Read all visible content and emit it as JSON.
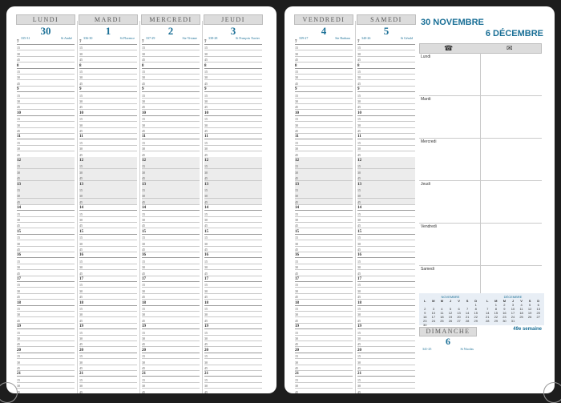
{
  "left_days": [
    {
      "name": "LUNDI",
      "num": "30",
      "code": "335-31",
      "saint": "St André"
    },
    {
      "name": "MARDI",
      "num": "1",
      "code": "336-30",
      "saint": "St Florence"
    },
    {
      "name": "MERCREDI",
      "num": "2",
      "code": "337-29",
      "saint": "Ste Viviane"
    },
    {
      "name": "JEUDI",
      "num": "3",
      "code": "338-28",
      "saint": "St François Xavier"
    }
  ],
  "right_days": [
    {
      "name": "VENDREDI",
      "num": "4",
      "code": "339-27",
      "saint": "Ste Barbara"
    },
    {
      "name": "SAMEDI",
      "num": "5",
      "code": "340-26",
      "saint": "St Gérald"
    }
  ],
  "hours": [
    "7",
    "8",
    "9",
    "10",
    "11",
    "12",
    "13",
    "14",
    "15",
    "16",
    "17",
    "18",
    "19",
    "20",
    "21"
  ],
  "header_range_start": "30 NOVEMBRE",
  "header_range_end": "6 DÉCEMBRE",
  "icons": {
    "left": "telephone-icon",
    "right": "envelope-icon"
  },
  "notes_days": [
    "Lundi",
    "Mardi",
    "Mercredi",
    "Jeudi",
    "Vendredi",
    "Samedi"
  ],
  "calendars": {
    "nov": {
      "title": "NOVEMBRE",
      "headers": [
        "L",
        "M",
        "M",
        "J",
        "V",
        "S",
        "D"
      ],
      "cells": [
        "",
        "",
        "",
        "",
        "",
        "",
        "1",
        "2",
        "3",
        "4",
        "5",
        "6",
        "7",
        "8",
        "9",
        "10",
        "11",
        "12",
        "13",
        "14",
        "15",
        "16",
        "17",
        "18",
        "19",
        "20",
        "21",
        "22",
        "23",
        "24",
        "25",
        "26",
        "27",
        "28",
        "29",
        "30",
        "",
        "",
        "",
        "",
        "",
        ""
      ]
    },
    "dec": {
      "title": "DÉCEMBRE",
      "headers": [
        "L",
        "M",
        "M",
        "J",
        "V",
        "S",
        "D"
      ],
      "cells": [
        "",
        "1",
        "2",
        "3",
        "4",
        "5",
        "6",
        "7",
        "8",
        "9",
        "10",
        "11",
        "12",
        "13",
        "14",
        "15",
        "16",
        "17",
        "18",
        "19",
        "20",
        "21",
        "22",
        "23",
        "24",
        "25",
        "26",
        "27",
        "28",
        "29",
        "30",
        "31",
        "",
        "",
        ""
      ]
    }
  },
  "sunday": {
    "name": "DIMANCHE",
    "num": "6",
    "code": "341-25",
    "saint": "St Nicolas"
  },
  "week": "49e semaine"
}
